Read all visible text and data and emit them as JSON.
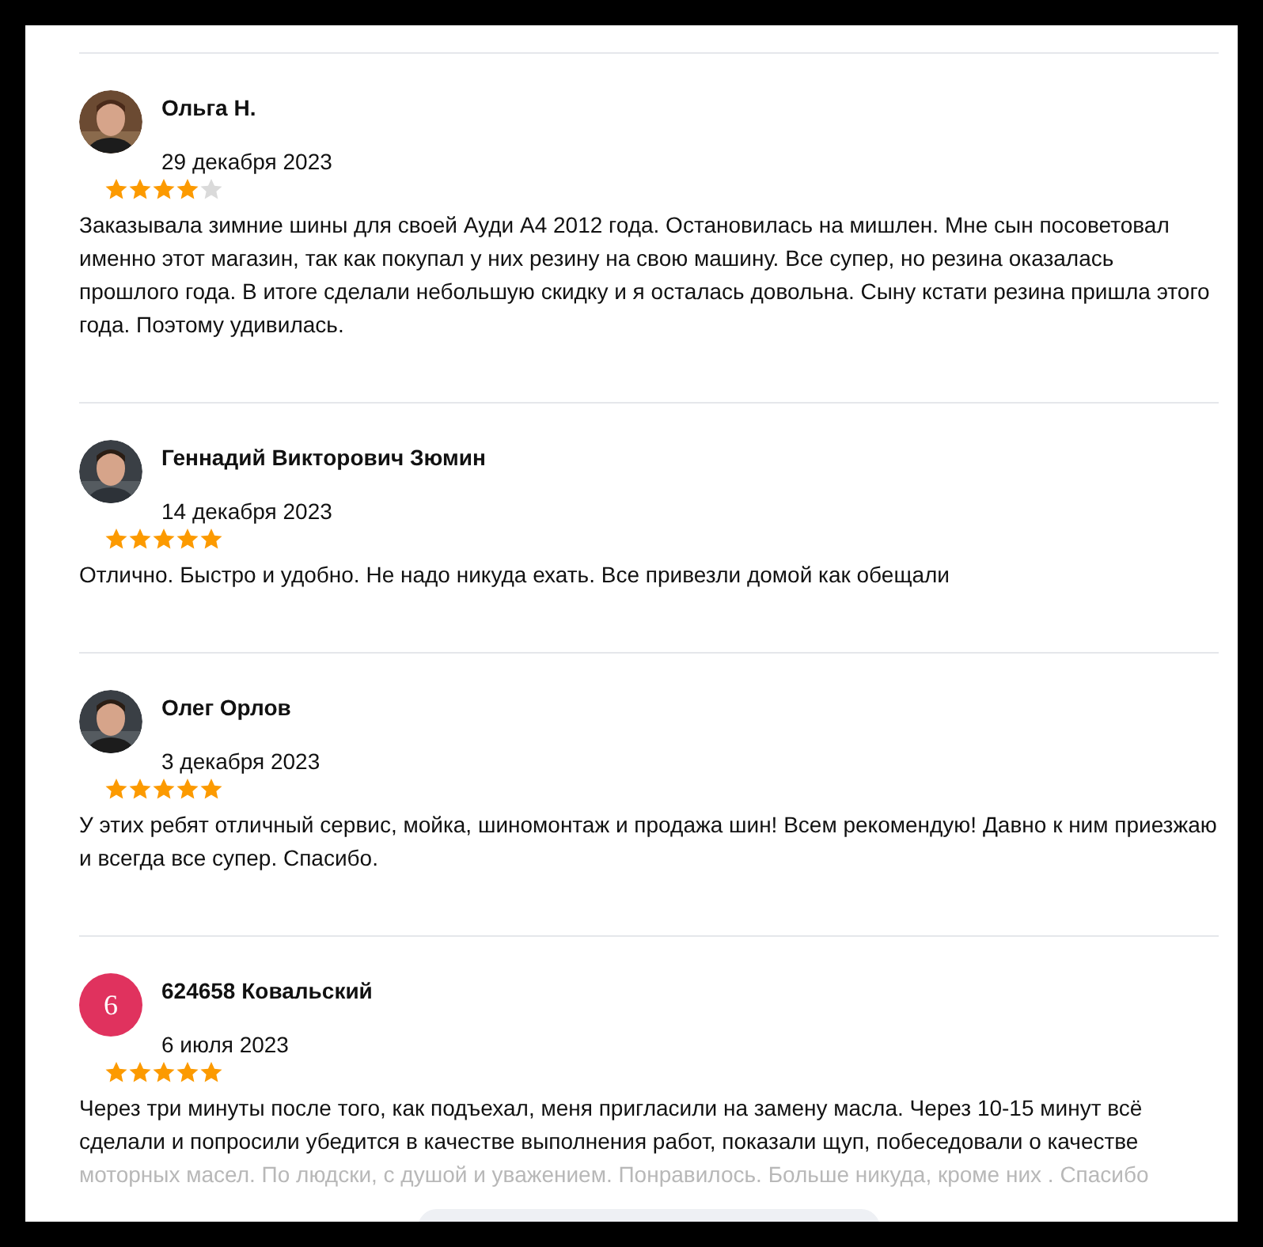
{
  "reviews": [
    {
      "author": "Ольга Н.",
      "date": "29 декабря 2023",
      "stars": 4,
      "text": "Заказывала зимние шины для своей Ауди А4  2012 года. Остановилась на мишлен. Мне сын посоветовал именно этот магазин, так как покупал у них резину на свою машину. Все супер, но резина оказалась прошлого года. В итоге сделали небольшую скидку и я осталась довольна. Сыну кстати резина пришла этого года. Поэтому удивилась."
    },
    {
      "author": "Геннадий Викторович Зюмин",
      "date": "14 декабря 2023",
      "stars": 5,
      "text": "Отлично. Быстро и удобно. Не надо никуда ехать. Все привезли домой как обещали"
    },
    {
      "author": "Олег Орлов",
      "date": "3 декабря 2023",
      "stars": 5,
      "text": "У этих ребят отличный сервис, мойка, шиномонтаж и продажа шин! Всем рекомендую! Давно к ним приезжаю и всегда все супер. Спасибо."
    },
    {
      "author": "624658 Ковальский",
      "date": "6 июля 2023",
      "stars": 5,
      "avatar": {
        "kind": "letter",
        "letter": "6"
      },
      "text": "Через три минуты после того, как подъехал, меня пригласили на замену масла. Через 10-15 минут всё сделали и попросили убедится в качестве выполнения работ, показали щуп, побеседовали о качестве",
      "faded_text": "моторных масел. По людски, с душой и уважением. Понравилось. Больше никуда, кроме них . Спасибо"
    }
  ]
}
